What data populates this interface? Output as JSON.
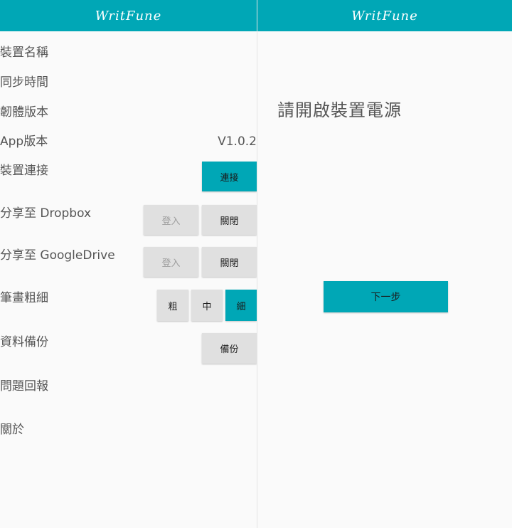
{
  "left_screen": {
    "app_logo": "WritFune",
    "settings": {
      "device_name_label": "裝置名稱",
      "sync_time_label": "同步時間",
      "firmware_label": "韌體版本",
      "app_version_label": "App版本",
      "app_version_value": "V1.0.2",
      "device_connection_label": "裝置連接",
      "connect_button": "連接",
      "share_dropbox_label": "分享至 Dropbox",
      "dropbox_login_button": "登入",
      "dropbox_off_button": "關閉",
      "share_googledrive_label": "分享至 GoogleDrive",
      "googledrive_login_button": "登入",
      "googledrive_off_button": "關閉",
      "pen_thickness_label": "筆畫粗細",
      "thickness_options": [
        "粗",
        "中",
        "細"
      ],
      "thickness_selected": "細",
      "data_backup_label": "資料備份",
      "backup_button": "備份",
      "feedback_label": "問題回報",
      "about_label": "關於"
    }
  },
  "right_screen": {
    "app_logo": "WritFune",
    "prompt": "請開啟裝置電源",
    "next_button": "下一步"
  },
  "colors": {
    "accent": "#00a7b6",
    "background": "#fafafa",
    "button_gray": "#e0e0e0",
    "text": "#555555"
  }
}
